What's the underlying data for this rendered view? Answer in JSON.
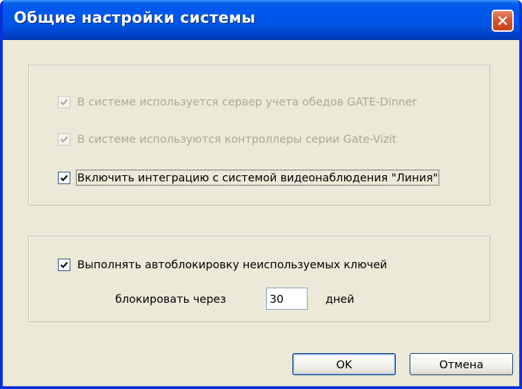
{
  "window": {
    "title": "Общие настройки системы"
  },
  "integration_group": {
    "options": [
      {
        "label": "В системе используется сервер учета обедов GATE-Dinner",
        "checked": true,
        "enabled": false
      },
      {
        "label": "В системе используются контроллеры серии Gate-Vizit",
        "checked": true,
        "enabled": false
      },
      {
        "label": "Включить интеграцию с системой видеонаблюдения \"Линия\"",
        "checked": true,
        "enabled": true
      }
    ]
  },
  "autoblock_group": {
    "enable_label": "Выполнять автоблокировку неиспользуемых ключей",
    "enable_checked": true,
    "block_after_label": "блокировать через",
    "days_value": "30",
    "days_unit": "дней"
  },
  "buttons": {
    "ok_label": "OK",
    "cancel_label": "Отмена"
  },
  "colors": {
    "titlebar": "#0055e5",
    "dialog_bg": "#ece9d8",
    "close_button": "#d8572d",
    "disabled_text": "#aca899"
  },
  "icons": {
    "close": "close-icon",
    "check": "checkmark-icon"
  }
}
